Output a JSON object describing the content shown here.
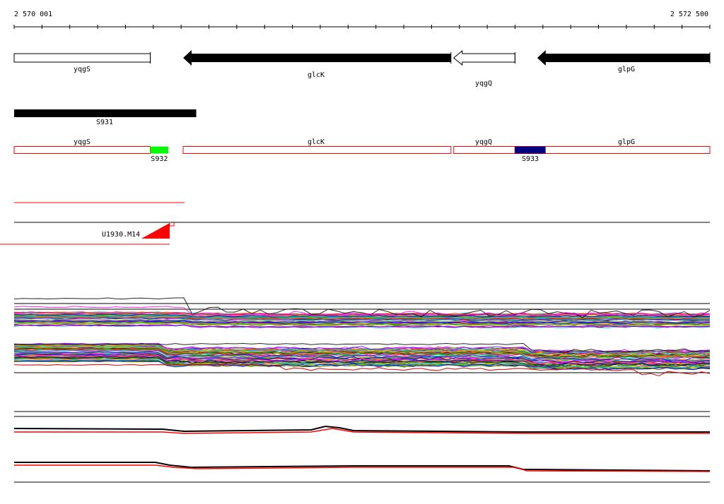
{
  "ruler": {
    "start_label": "2 570 001",
    "end_label": "2 572 500",
    "start": 2570001,
    "end": 2572500
  },
  "genes": [
    {
      "name": "yqgS",
      "start": 2570001,
      "end": 2570490,
      "strand": "+",
      "style": "open"
    },
    {
      "name": "glcK",
      "start": 2570608,
      "end": 2571570,
      "strand": "-",
      "style": "filled"
    },
    {
      "name": "yqgQ",
      "start": 2571580,
      "end": 2571800,
      "strand": "+",
      "style": "open-left"
    },
    {
      "name": "glpG",
      "start": 2571880,
      "end": 2572500,
      "strand": "-",
      "style": "filled"
    }
  ],
  "segments": [
    {
      "name": "S931",
      "start": 2570001,
      "end": 2570655
    }
  ],
  "transcription_units": [
    {
      "label": "yqgS",
      "start": 2570001,
      "end": 2570490
    },
    {
      "label": "glcK",
      "start": 2570608,
      "end": 2571570
    },
    {
      "label": "yqgQ",
      "start": 2571580,
      "end": 2571800
    },
    {
      "label": "glpG",
      "start": 2571800,
      "end": 2572500
    }
  ],
  "boxes": [
    {
      "name": "S932",
      "start": 2570490,
      "end": 2570555,
      "color": "#00ff00"
    },
    {
      "name": "S933",
      "start": 2571800,
      "end": 2571910,
      "color": "#000080"
    }
  ],
  "upshift": {
    "label": "U1930.M14",
    "color": "#ff0000"
  },
  "colors": {
    "gene": "#000000",
    "tu_border": "#ff0000",
    "expr_black": "#000000",
    "expr_red": "#ff0000"
  }
}
